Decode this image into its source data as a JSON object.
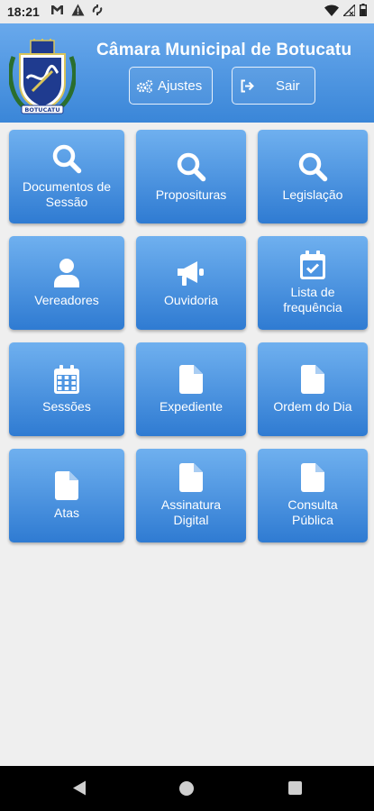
{
  "status_bar": {
    "time": "18:21",
    "icons": [
      "gmail-icon",
      "warning-icon",
      "sync-icon",
      "wifi-icon",
      "signal-icon",
      "battery-icon"
    ]
  },
  "header": {
    "title": "Câmara Municipal de Botucatu",
    "settings_label": "Ajustes",
    "logout_label": "Sair",
    "logo_text": "BOTUCATU"
  },
  "tiles": [
    {
      "label": "Documentos de\nSessão",
      "icon": "search-icon"
    },
    {
      "label": "Proposituras",
      "icon": "search-icon"
    },
    {
      "label": "Legislação",
      "icon": "search-icon"
    },
    {
      "label": "Vereadores",
      "icon": "user-icon"
    },
    {
      "label": "Ouvidoria",
      "icon": "megaphone-icon"
    },
    {
      "label": "Lista de\nfrequência",
      "icon": "calendar-check-icon"
    },
    {
      "label": "Sessões",
      "icon": "calendar-icon"
    },
    {
      "label": "Expediente",
      "icon": "document-icon"
    },
    {
      "label": "Ordem do Dia",
      "icon": "document-icon"
    },
    {
      "label": "Atas",
      "icon": "document-icon"
    },
    {
      "label": "Assinatura\nDigital",
      "icon": "document-icon"
    },
    {
      "label": "Consulta\nPública",
      "icon": "document-icon"
    }
  ],
  "colors": {
    "header_top": "#69a9ec",
    "header_bottom": "#3a86d8",
    "tile_top": "#6fb0ef",
    "tile_bottom": "#2f7bd2",
    "background": "#efefef"
  }
}
